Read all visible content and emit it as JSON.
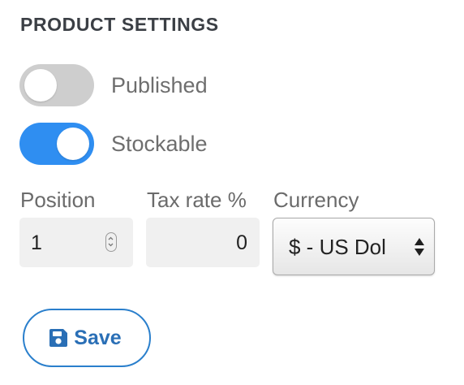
{
  "section": {
    "title": "PRODUCT SETTINGS"
  },
  "toggles": [
    {
      "label": "Published",
      "checked": false
    },
    {
      "label": "Stockable",
      "checked": true
    }
  ],
  "fields": {
    "position": {
      "label": "Position",
      "value": "1"
    },
    "tax_rate": {
      "label": "Tax rate %",
      "value": "0"
    },
    "currency": {
      "label": "Currency",
      "selected": "$ - US Dol"
    }
  },
  "actions": {
    "save_label": "Save"
  },
  "colors": {
    "toggle_on": "#2f8ef1",
    "toggle_off": "#cecece",
    "accent": "#2a7fcc"
  },
  "icons": {
    "save": "floppy-disk-icon",
    "stepper": "up-down-stepper-icon",
    "select_arrows": "sort-arrows-icon"
  }
}
